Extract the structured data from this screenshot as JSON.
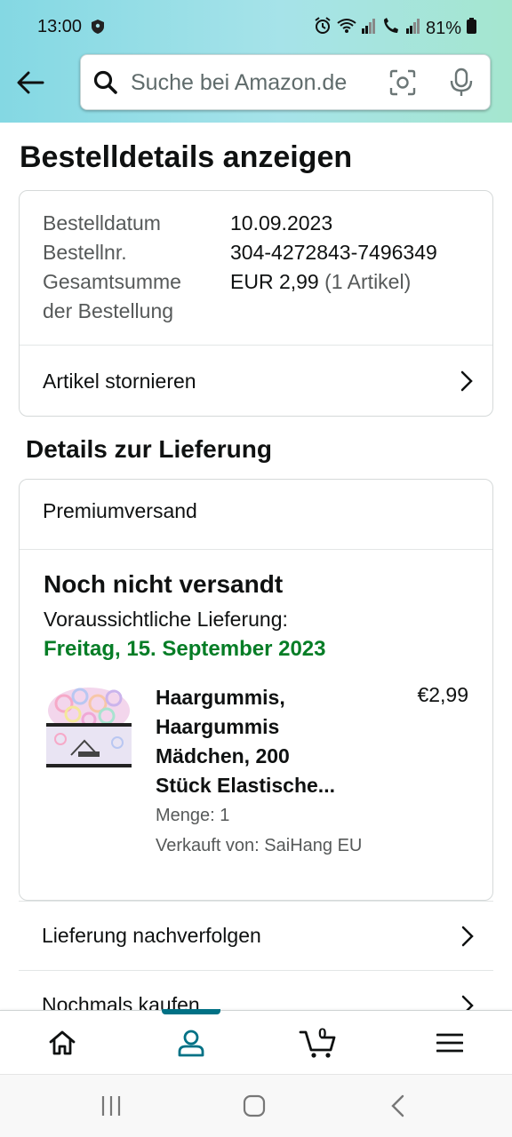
{
  "status_bar": {
    "time": "13:00",
    "battery": "81%"
  },
  "search": {
    "placeholder": "Suche bei Amazon.de"
  },
  "page": {
    "title": "Bestelldetails anzeigen"
  },
  "order": {
    "date_label": "Bestelldatum",
    "date_value": "10.09.2023",
    "number_label": "Bestellnr.",
    "number_value": "304-4272843-7496349",
    "total_label_1": "Gesamtsumme",
    "total_label_2": "der Bestellung",
    "total_value": "EUR 2,99",
    "total_items": "(1 Artikel)",
    "cancel_label": "Artikel stornieren"
  },
  "delivery": {
    "section_title": "Details zur Lieferung",
    "shipping_method": "Premiumversand",
    "status": "Noch nicht versandt",
    "expected_label": "Voraussichtliche Lieferung:",
    "expected_date": "Freitag, 15. September 2023",
    "expected_date_color": "#067d26"
  },
  "product": {
    "name_lines": [
      "Haargummis,",
      "Haargummis",
      "Mädchen, 200",
      "Stück Elastische..."
    ],
    "price": "€2,99",
    "quantity": "Menge: 1",
    "seller": "Verkauft von: SaiHang EU"
  },
  "actions": {
    "track": "Lieferung nachverfolgen",
    "buy_again": "Nochmals kaufen"
  },
  "bottom_nav": {
    "items": [
      "home-icon",
      "account-icon",
      "cart-icon",
      "menu-icon"
    ],
    "active": "account-icon",
    "cart_count": "0",
    "accent": "#007185"
  },
  "system_nav": [
    "recents-icon",
    "home-circle-icon",
    "back-chevron-icon"
  ]
}
